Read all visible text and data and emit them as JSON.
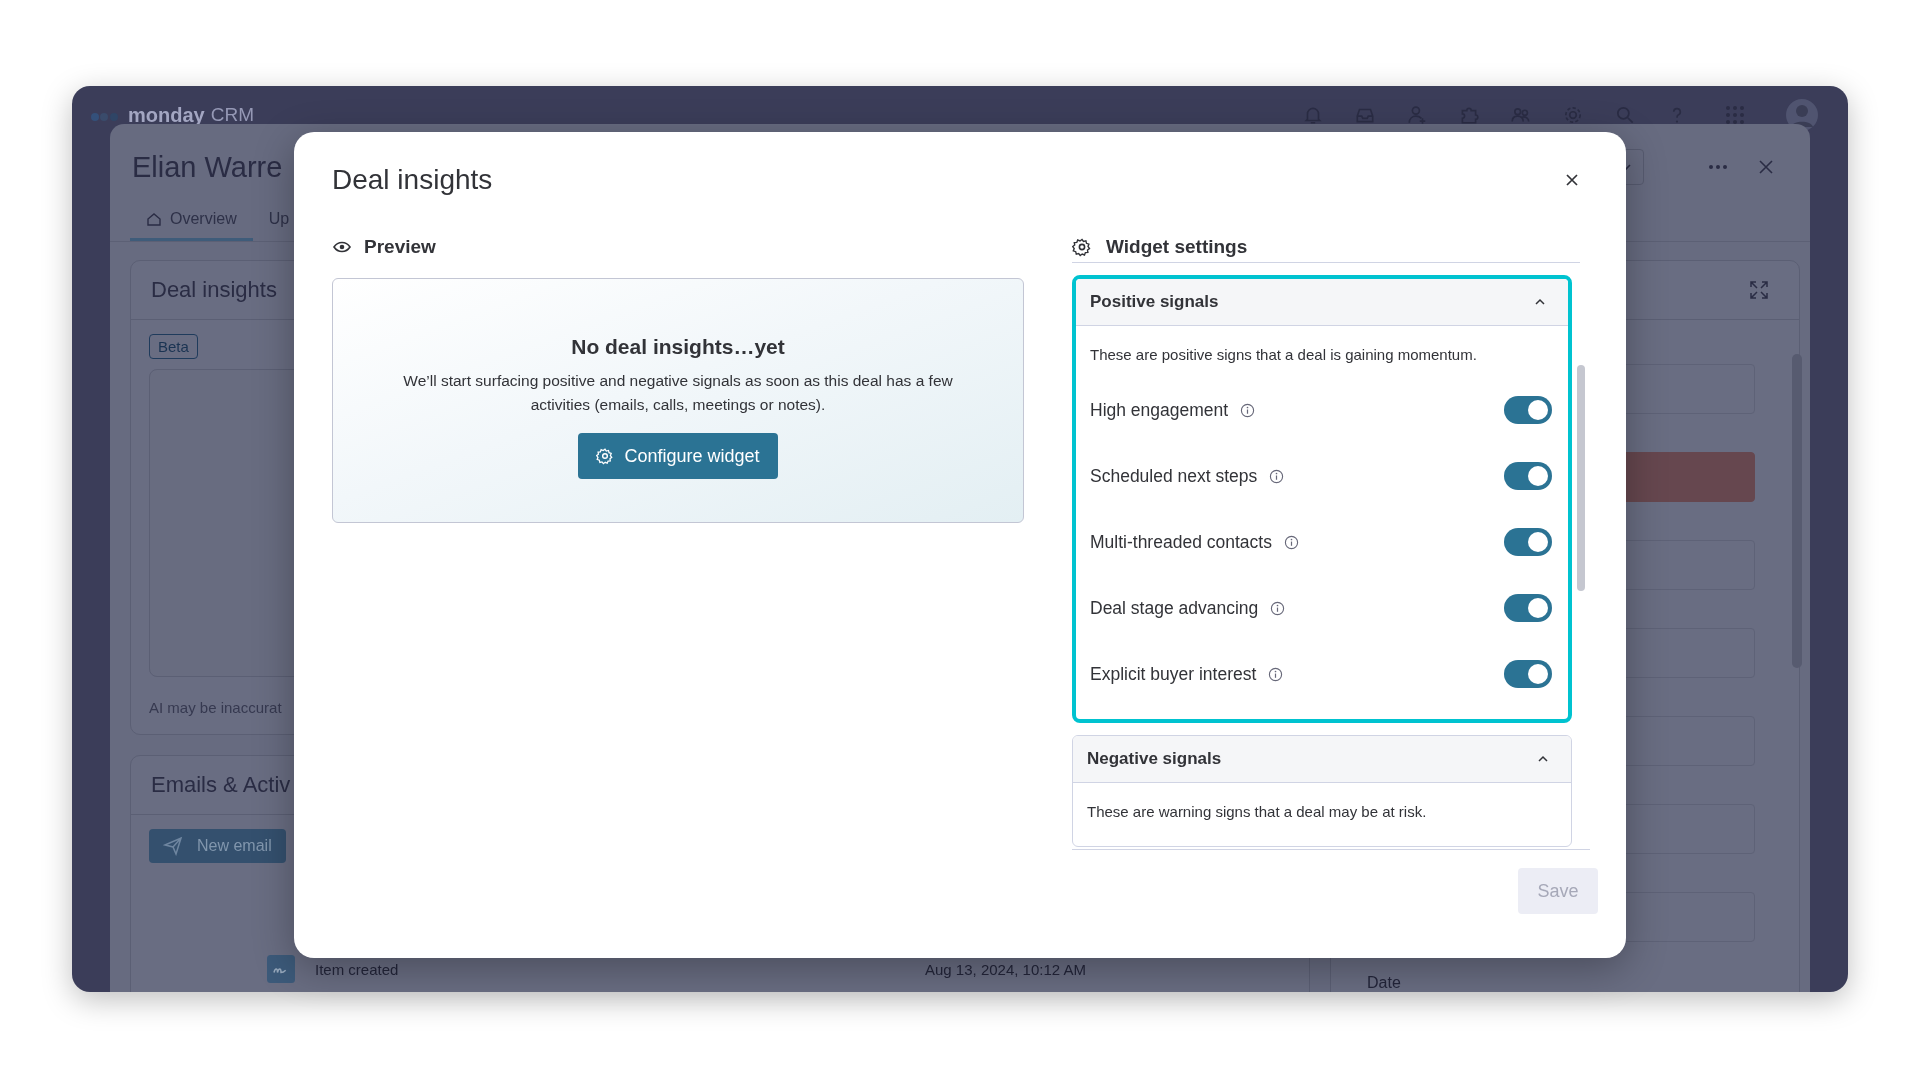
{
  "app": {
    "logo_text": "monday",
    "product": "CRM",
    "record_title": "Elian Warre",
    "tabs": [
      {
        "label": "Overview",
        "selected": true
      },
      {
        "label": "Up",
        "selected": false
      }
    ],
    "insights_card": {
      "title": "Deal insights",
      "badge": "Beta",
      "footnote": "AI may be inaccurat"
    },
    "activity_card": {
      "title": "Emails & Activ",
      "new_email_button": "New email",
      "item": {
        "text": "Item created",
        "time": "Aug 13, 2024, 10:12 AM"
      }
    },
    "side_label": "Date"
  },
  "dialog": {
    "title": "Deal insights",
    "preview": {
      "heading": "Preview",
      "empty_title": "No deal insights…yet",
      "empty_text": "We’ll start surfacing positive and negative signals as soon as this deal has a few activities (emails, calls, meetings or notes).",
      "configure_button": "Configure widget"
    },
    "settings": {
      "heading": "Widget settings",
      "sections": [
        {
          "title": "Positive signals",
          "expanded": true,
          "highlighted": true,
          "description": "These are positive signs that a deal is gaining momentum.",
          "items": [
            {
              "label": "High engagement",
              "on": true
            },
            {
              "label": "Scheduled next steps",
              "on": true
            },
            {
              "label": "Multi-threaded contacts",
              "on": true
            },
            {
              "label": "Deal stage advancing",
              "on": true
            },
            {
              "label": "Explicit buyer interest",
              "on": true
            }
          ]
        },
        {
          "title": "Negative signals",
          "expanded": true,
          "highlighted": false,
          "description": "These are warning signs that a deal may be at risk."
        }
      ]
    },
    "save_button": {
      "label": "Save",
      "disabled": true
    }
  }
}
